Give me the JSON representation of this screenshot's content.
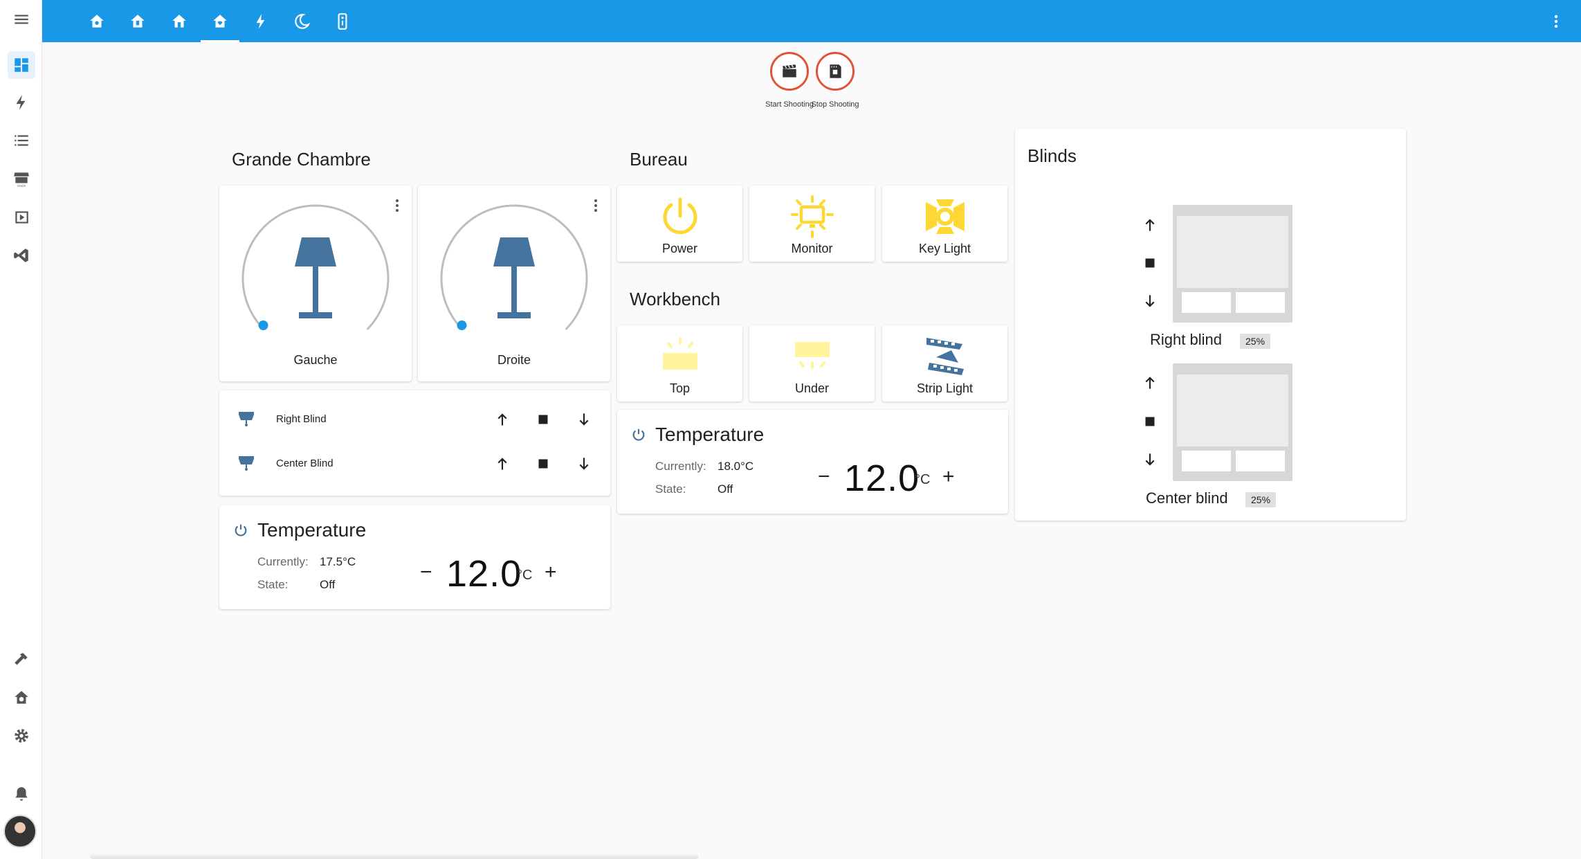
{
  "sidebar": {
    "items": [
      {
        "icon": "menu-icon",
        "label": "Menu"
      },
      {
        "icon": "dashboard-icon",
        "label": "Overview"
      },
      {
        "icon": "lightning-icon",
        "label": "Energy"
      },
      {
        "icon": "list-icon",
        "label": "Logbook"
      },
      {
        "icon": "store-icon",
        "label": "HACS"
      },
      {
        "icon": "media-icon",
        "label": "Media"
      },
      {
        "icon": "vscode-icon",
        "label": "Studio Code Server"
      },
      {
        "icon": "hammer-icon",
        "label": "Developer Tools"
      },
      {
        "icon": "home-gear-icon",
        "label": "Supervisor"
      },
      {
        "icon": "gear-icon",
        "label": "Settings"
      },
      {
        "icon": "bell-icon",
        "label": "Notifications"
      }
    ]
  },
  "header": {
    "tabs": [
      "house-cog-icon",
      "house-badge-icon",
      "house-icon",
      "house-heart-icon",
      "lightning-icon",
      "moon-icon",
      "remote-icon"
    ],
    "active_tab": 3,
    "accent": "#1998e8"
  },
  "scripts": [
    {
      "label": "Start Shooting",
      "icon": "clapperboard-icon"
    },
    {
      "label": "Stop Shooting",
      "icon": "film-stop-icon"
    }
  ],
  "grande_chambre": {
    "title": "Grande Chambre",
    "lights": [
      {
        "name": "Gauche",
        "icon": "lamp-icon",
        "brightness": 0
      },
      {
        "name": "Droite",
        "icon": "lamp-icon",
        "brightness": 0
      }
    ],
    "blinds": [
      {
        "name": "Right Blind",
        "icon": "blind-icon"
      },
      {
        "name": "Center Blind",
        "icon": "blind-icon"
      }
    ],
    "thermostat": {
      "title": "Temperature",
      "currently_label": "Currently:",
      "currently": "17.5°C",
      "state_label": "State:",
      "state": "Off",
      "target": "12.0",
      "unit": "°C",
      "minus": "−",
      "plus": "+"
    }
  },
  "bureau": {
    "title": "Bureau",
    "tiles": [
      {
        "name": "Power",
        "icon": "power-icon"
      },
      {
        "name": "Monitor",
        "icon": "monitor-icon"
      },
      {
        "name": "Key Light",
        "icon": "key-light-icon"
      }
    ]
  },
  "workbench": {
    "title": "Workbench",
    "tiles": [
      {
        "name": "Top",
        "icon": "top-light-icon"
      },
      {
        "name": "Under",
        "icon": "under-light-icon"
      },
      {
        "name": "Strip Light",
        "icon": "led-strip-icon"
      }
    ],
    "thermostat": {
      "title": "Temperature",
      "currently_label": "Currently:",
      "currently": "18.0°C",
      "state_label": "State:",
      "state": "Off",
      "target": "12.0",
      "unit": "°C",
      "minus": "−",
      "plus": "+"
    }
  },
  "blinds_card": {
    "title": "Blinds",
    "items": [
      {
        "name": "Right blind",
        "position": "25%"
      },
      {
        "name": "Center blind",
        "position": "25%"
      }
    ]
  },
  "colors": {
    "on": "#fdd835",
    "off_light": "#fff59d",
    "icon_blue": "#44739e",
    "script_border": "#e0533b",
    "slider_thumb": "#1998e8"
  }
}
